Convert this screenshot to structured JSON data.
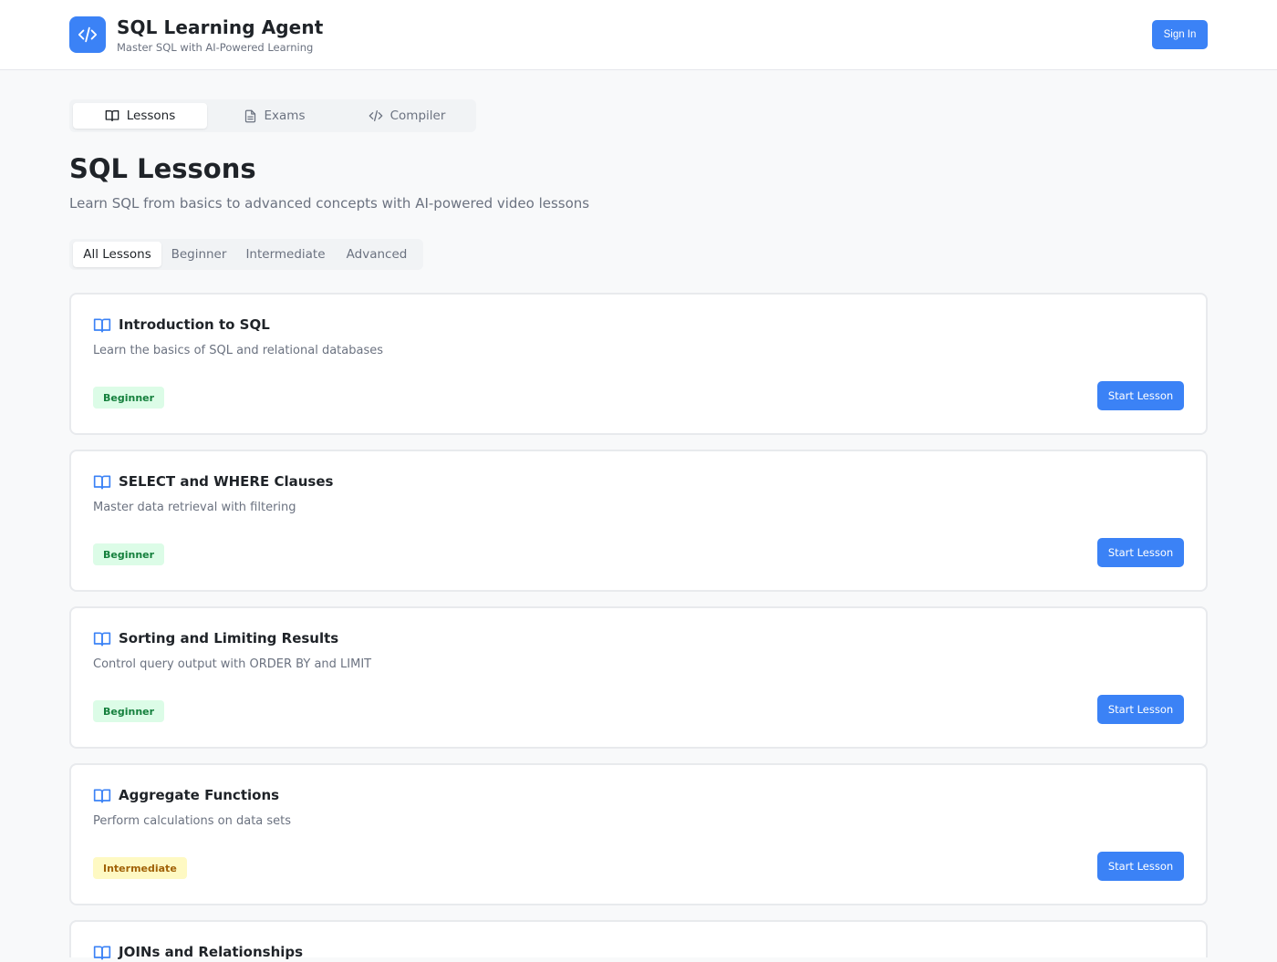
{
  "header": {
    "title": "SQL Learning Agent",
    "subtitle": "Master SQL with AI-Powered Learning",
    "logo_icon": "code-icon",
    "signin_label": "Sign In"
  },
  "main_tabs": [
    {
      "label": "Lessons",
      "icon": "book-icon",
      "active": true
    },
    {
      "label": "Exams",
      "icon": "document-icon",
      "active": false
    },
    {
      "label": "Compiler",
      "icon": "code-icon",
      "active": false
    }
  ],
  "page": {
    "title": "SQL Lessons",
    "subtitle": "Learn SQL from basics to advanced concepts with AI-powered video lessons"
  },
  "filter_tabs": [
    {
      "label": "All Lessons",
      "active": true
    },
    {
      "label": "Beginner",
      "active": false
    },
    {
      "label": "Intermediate",
      "active": false
    },
    {
      "label": "Advanced",
      "active": false
    }
  ],
  "lessons": [
    {
      "title": "Introduction to SQL",
      "description": "Learn the basics of SQL and relational databases",
      "level": "Beginner",
      "button": "Start Lesson"
    },
    {
      "title": "SELECT and WHERE Clauses",
      "description": "Master data retrieval with filtering",
      "level": "Beginner",
      "button": "Start Lesson"
    },
    {
      "title": "Sorting and Limiting Results",
      "description": "Control query output with ORDER BY and LIMIT",
      "level": "Beginner",
      "button": "Start Lesson"
    },
    {
      "title": "Aggregate Functions",
      "description": "Perform calculations on data sets",
      "level": "Intermediate",
      "button": "Start Lesson"
    },
    {
      "title": "JOINs and Relationships",
      "description": "",
      "level": "",
      "button": ""
    }
  ],
  "colors": {
    "accent": "#3b82f6",
    "beginner_bg": "#dcfce7",
    "beginner_text": "#15803d",
    "intermediate_bg": "#fef9c3",
    "intermediate_text": "#a16207"
  }
}
